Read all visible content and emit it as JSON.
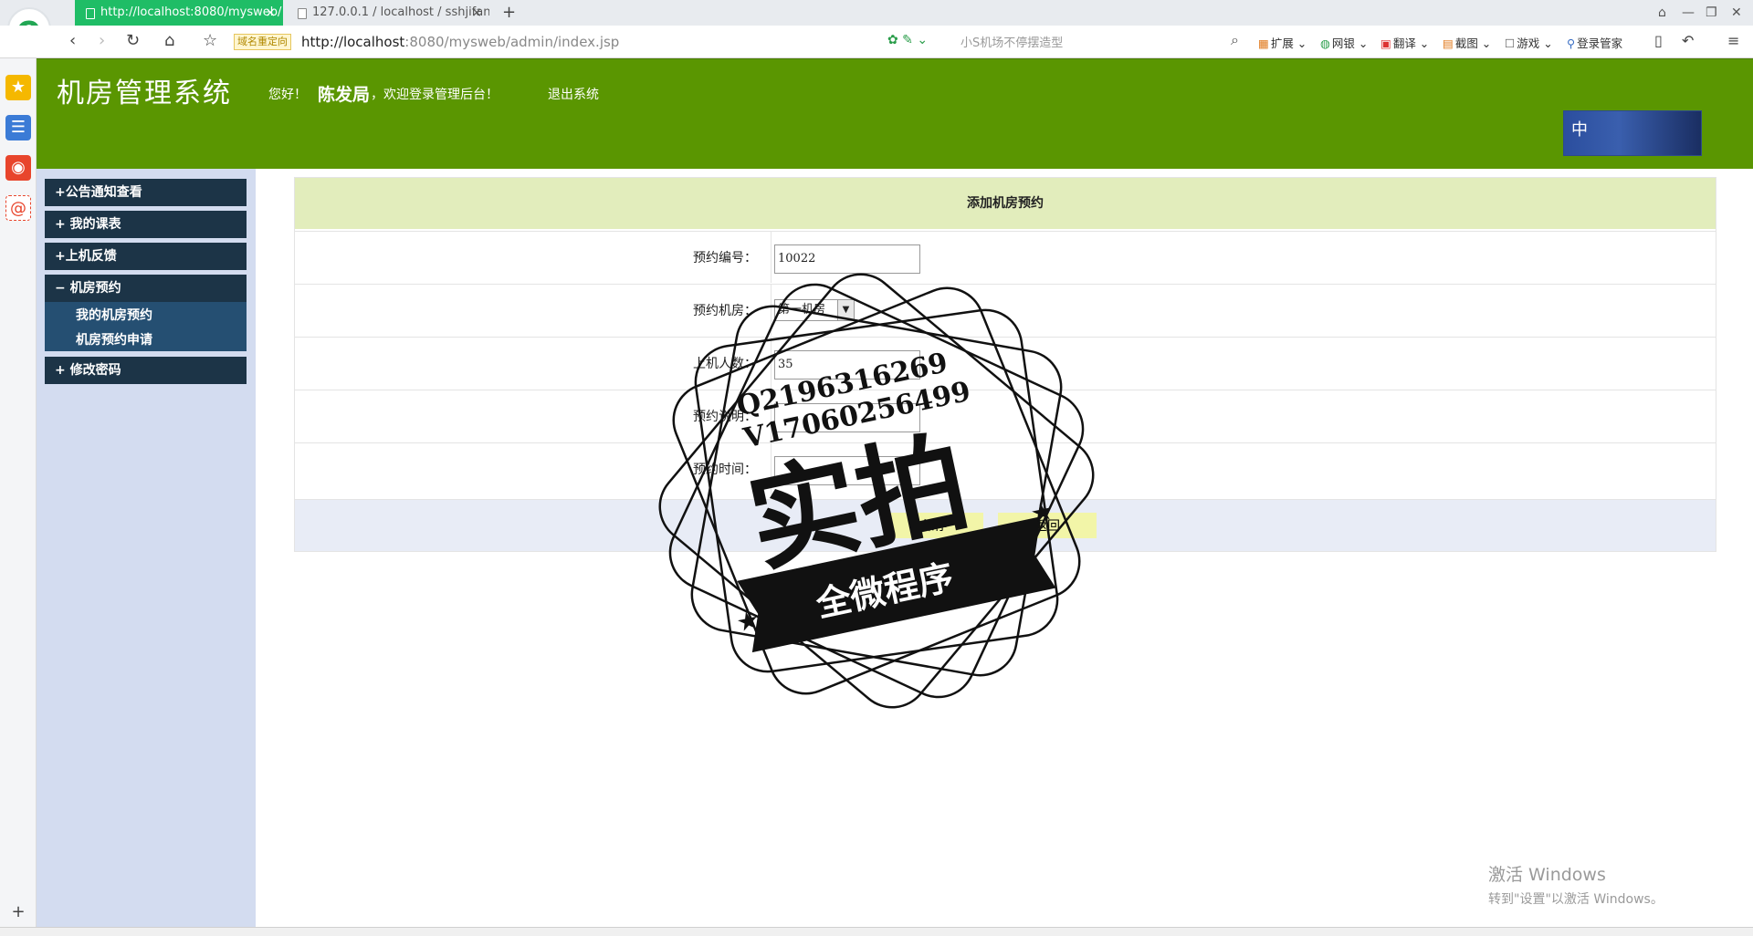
{
  "browser": {
    "tabs": [
      {
        "title": "http://localhost:8080/mysweb/",
        "active": true
      },
      {
        "title": "127.0.0.1 / localhost / sshjifan",
        "active": false
      }
    ],
    "new_tab": "+",
    "redirect_badge": "域名重定向",
    "url_host": "http://localhost",
    "url_rest": ":8080/mysweb/admin/index.jsp",
    "search_placeholder": "小S机场不停摆造型",
    "tools": [
      "扩展",
      "网银",
      "翻译",
      "截图",
      "游戏",
      "登录管家"
    ]
  },
  "header": {
    "system_title": "机房管理系统",
    "greeting_prefix": "您好！",
    "user_name": "陈发局",
    "greeting_suffix": "，欢迎登录管理后台！",
    "logout_label": "退出系统",
    "badge_text": "中"
  },
  "menu": {
    "items": [
      {
        "label": "+公告通知查看"
      },
      {
        "label": "+ 我的课表"
      },
      {
        "label": "+上机反馈"
      },
      {
        "label": "− 机房预约"
      },
      {
        "label": "+ 修改密码"
      }
    ],
    "submenu": [
      {
        "label": "我的机房预约"
      },
      {
        "label": "机房预约申请"
      }
    ]
  },
  "form": {
    "title": "添加机房预约",
    "fields": [
      {
        "label": "预约编号：",
        "value": "10022"
      },
      {
        "label": "预约机房：",
        "value": "第一机房"
      },
      {
        "label": "上机人数：",
        "value": "35"
      },
      {
        "label": "预约说明：",
        "value": ""
      },
      {
        "label": "预约时间：",
        "value": ""
      }
    ],
    "save_label": "保存",
    "back_label": "返回"
  },
  "watermark": {
    "line1": "Q2196316269",
    "line2": "V17060256499",
    "big": "实拍",
    "banner": "全微程序"
  },
  "os_notice": {
    "title": "激活 Windows",
    "subtitle": "转到\"设置\"以激活 Windows。"
  }
}
